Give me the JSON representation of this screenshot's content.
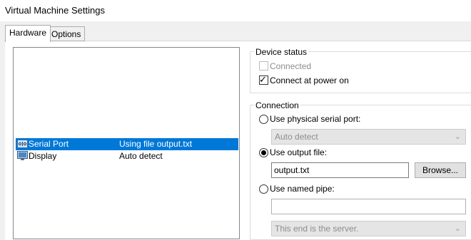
{
  "window": {
    "title": "Virtual Machine Settings"
  },
  "tabs": [
    {
      "label": "Hardware",
      "active": true
    },
    {
      "label": "Options",
      "active": false
    }
  ],
  "devices": [
    {
      "name": "Serial Port",
      "summary": "Using file output.txt",
      "selected": true,
      "icon": "serial-port-icon"
    },
    {
      "name": "Display",
      "summary": "Auto detect",
      "selected": false,
      "icon": "display-icon"
    }
  ],
  "device_status": {
    "legend": "Device status",
    "connected": {
      "label": "Connected",
      "checked": false,
      "disabled": true
    },
    "connect_at_power_on": {
      "label": "Connect at power on",
      "checked": true
    }
  },
  "connection": {
    "legend": "Connection",
    "physical": {
      "label": "Use physical serial port:",
      "selected": false,
      "select_value": "Auto detect"
    },
    "output_file": {
      "label": "Use output file:",
      "selected": true,
      "value": "output.txt",
      "browse_label": "Browse..."
    },
    "named_pipe": {
      "label": "Use named pipe:",
      "selected": false,
      "value": "",
      "end_select_value": "This end is the server."
    }
  },
  "colors": {
    "selection": "#0078d7",
    "window_bg": "#f0f0f0"
  }
}
